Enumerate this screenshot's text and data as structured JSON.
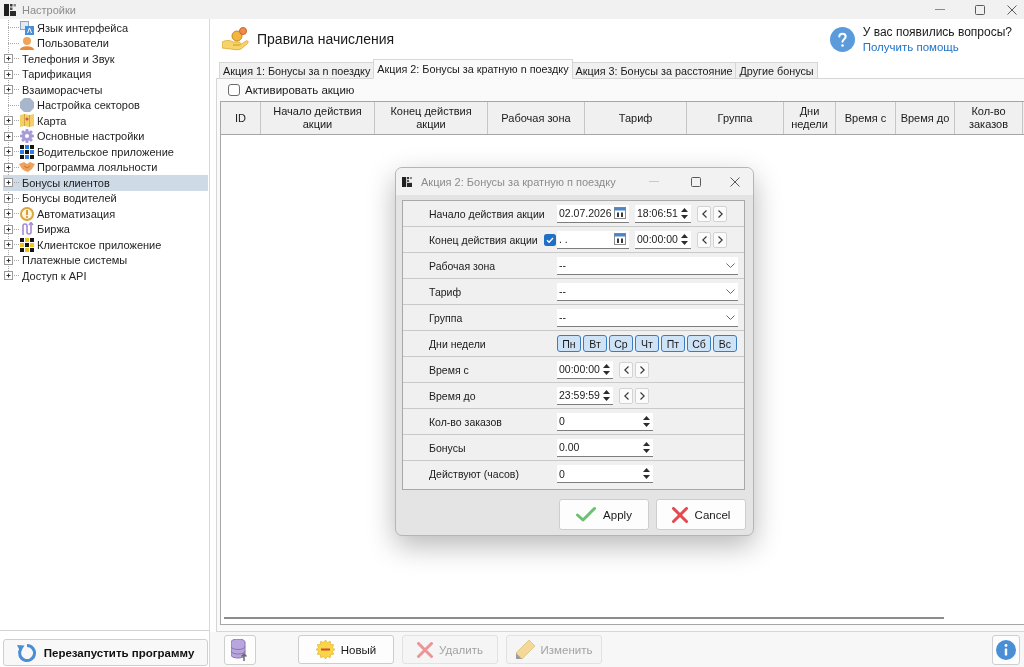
{
  "window": {
    "title": "Настройки"
  },
  "sidebar": {
    "items": [
      {
        "label": "Язык интерфейса",
        "kind": "leaf",
        "selected": false
      },
      {
        "label": "Пользователи",
        "kind": "leaf",
        "selected": false
      },
      {
        "label": "Телефония и Звук",
        "kind": "group",
        "selected": false
      },
      {
        "label": "Тарификация",
        "kind": "group",
        "selected": false
      },
      {
        "label": "Взаиморасчеты",
        "kind": "group",
        "selected": false
      },
      {
        "label": "Настройка секторов",
        "kind": "leaf",
        "selected": false
      },
      {
        "label": "Карта",
        "kind": "group",
        "selected": false
      },
      {
        "label": "Основные настройки",
        "kind": "group",
        "selected": false
      },
      {
        "label": "Водительское приложение",
        "kind": "group",
        "selected": false
      },
      {
        "label": "Программа лояльности",
        "kind": "group",
        "selected": false
      },
      {
        "label": "Бонусы клиентов",
        "kind": "group",
        "selected": true
      },
      {
        "label": "Бонусы водителей",
        "kind": "group",
        "selected": false
      },
      {
        "label": "Автоматизация",
        "kind": "group",
        "selected": false
      },
      {
        "label": "Биржа",
        "kind": "group",
        "selected": false
      },
      {
        "label": "Клиентское приложение",
        "kind": "group",
        "selected": false
      },
      {
        "label": "Платежные системы",
        "kind": "group",
        "selected": false
      },
      {
        "label": "Доступ к API",
        "kind": "group",
        "selected": false
      }
    ],
    "restart_button": "Перезапустить программу"
  },
  "header": {
    "title": "Правила начисления",
    "help_question": "У вас появились вопросы?",
    "help_link": "Получить помощь"
  },
  "tabs": [
    {
      "label": "Акция 1: Бонусы за n поездку",
      "selected": false
    },
    {
      "label": "Акция 2: Бонусы за кратную n поездку",
      "selected": true
    },
    {
      "label": "Акция 3: Бонусы за расстояние",
      "selected": false
    },
    {
      "label": "Другие бонусы",
      "selected": false
    }
  ],
  "activate": {
    "label": "Активировать акцию",
    "checked": false
  },
  "table": {
    "columns": [
      "ID",
      "Начало действия акции",
      "Конец действия акции",
      "Рабочая зона",
      "Тариф",
      "Группа",
      "Дни недели",
      "Время с",
      "Время до",
      "Кол-во заказов"
    ]
  },
  "toolbar": {
    "buttons": [
      {
        "kind": "new",
        "label": "Новый",
        "disabled": false
      },
      {
        "kind": "delete",
        "label": "Удалить",
        "disabled": true
      },
      {
        "kind": "edit",
        "label": "Изменить",
        "disabled": true
      }
    ]
  },
  "dialog": {
    "title": "Акция 2: Бонусы за кратную п поездку",
    "fields": [
      {
        "kind": "datetime",
        "label": "Начало действия акции",
        "date": "02.07.2026",
        "time": "18:06:51"
      },
      {
        "kind": "datetime_toggle",
        "label": "Конец действия акции",
        "checked": true,
        "date": ". .",
        "time": "00:00:00"
      },
      {
        "kind": "dropdown",
        "label": "Рабочая зона",
        "value": "--"
      },
      {
        "kind": "dropdown",
        "label": "Тариф",
        "value": "--"
      },
      {
        "kind": "dropdown",
        "label": "Группа",
        "value": "--"
      },
      {
        "kind": "days",
        "label": "Дни недели",
        "days": [
          {
            "label": "Пн",
            "selected": true
          },
          {
            "label": "Вт",
            "selected": true
          },
          {
            "label": "Ср",
            "selected": true
          },
          {
            "label": "Чт",
            "selected": true
          },
          {
            "label": "Пт",
            "selected": true
          },
          {
            "label": "Сб",
            "selected": true
          },
          {
            "label": "Вс",
            "selected": true
          }
        ]
      },
      {
        "kind": "time",
        "label": "Время с",
        "value": "00:00:00"
      },
      {
        "kind": "time",
        "label": "Время до",
        "value": "23:59:59"
      },
      {
        "kind": "spin",
        "label": "Кол-во заказов",
        "value": "0"
      },
      {
        "kind": "spin",
        "label": "Бонусы",
        "value": "0.00"
      },
      {
        "kind": "spin",
        "label": "Действуют (часов)",
        "value": "0"
      }
    ],
    "buttons": [
      {
        "kind": "apply",
        "label": "Apply"
      },
      {
        "kind": "cancel",
        "label": "Cancel"
      }
    ]
  }
}
